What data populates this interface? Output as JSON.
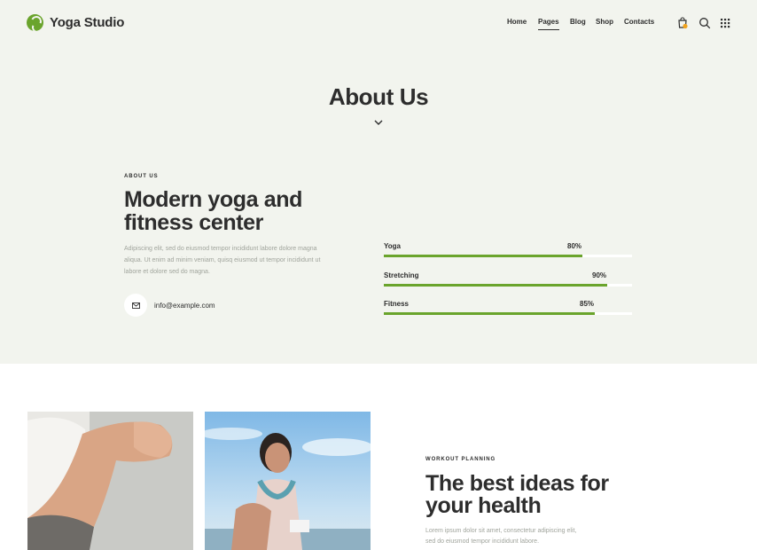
{
  "brand": {
    "name": "Yoga Studio",
    "accent": "#6aa42c"
  },
  "nav": {
    "items": [
      {
        "label": "Home"
      },
      {
        "label": "Pages"
      },
      {
        "label": "Blog"
      },
      {
        "label": "Shop"
      },
      {
        "label": "Contacts"
      }
    ],
    "active": "Pages"
  },
  "header_icons": [
    "cart-icon",
    "search-icon",
    "grid-menu-icon"
  ],
  "hero": {
    "title": "About Us",
    "icon": "chevron-down-icon"
  },
  "about": {
    "eyebrow": "ABOUT US",
    "heading_line1": "Modern yoga and",
    "heading_line2": "fitness center",
    "text_line1": "Adipiscing elit, sed do eiusmod tempor incididunt labore dolore magna",
    "text_line2": "aliqua. Ut enim ad minim veniam, quisq eiusmod ut tempor incididunt ut",
    "text_line3": "labore et dolore sed do magna.",
    "email": "info@example.com",
    "email_icon": "envelope-icon"
  },
  "skills": [
    {
      "label": "Yoga",
      "percent_text": "80%",
      "value": 0.8
    },
    {
      "label": "Stretching",
      "percent_text": "90%",
      "value": 0.9
    },
    {
      "label": "Fitness",
      "percent_text": "85%",
      "value": 0.85
    }
  ],
  "workout": {
    "eyebrow": "WORKOUT PLANNING",
    "heading_line1": "The best ideas for",
    "heading_line2": "your health",
    "text_line1": "Lorem ipsum dolor sit amet, consectetur adipiscing elit,",
    "text_line2": "sed do eiusmod tempor incididunt labore."
  }
}
